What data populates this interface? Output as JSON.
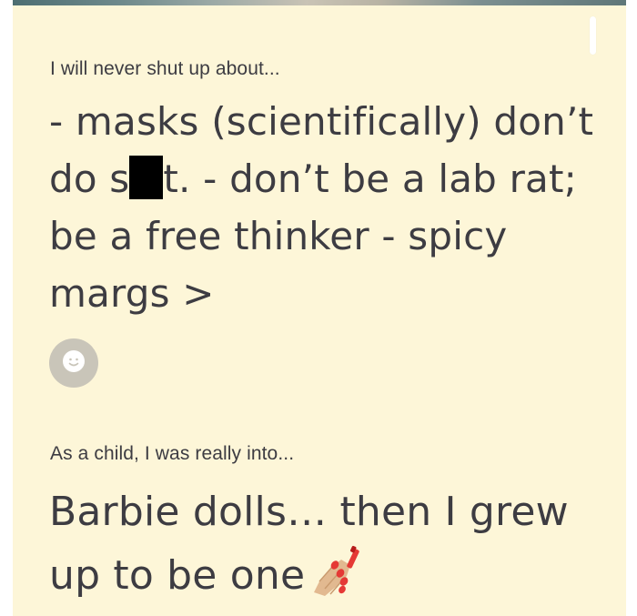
{
  "profile": {
    "prompts": [
      {
        "question": "I will never shut up about...",
        "answer_part_1": "- masks (scientifically) don’t do s",
        "answer_part_2": "t. - don’t be a lab rat; be a free thinker - spicy margs >"
      },
      {
        "question": "As a child, I was really into...",
        "answer": "Barbie dolls… then I grew up to be one",
        "emoji": "nail-polish-icon"
      }
    ],
    "react_button": {
      "icon": "smiley-face-icon"
    }
  },
  "colors": {
    "card_background": "#fdf6d8",
    "text": "#3d3c42",
    "react_button": "#c9c5b9",
    "censor": "#000000"
  }
}
